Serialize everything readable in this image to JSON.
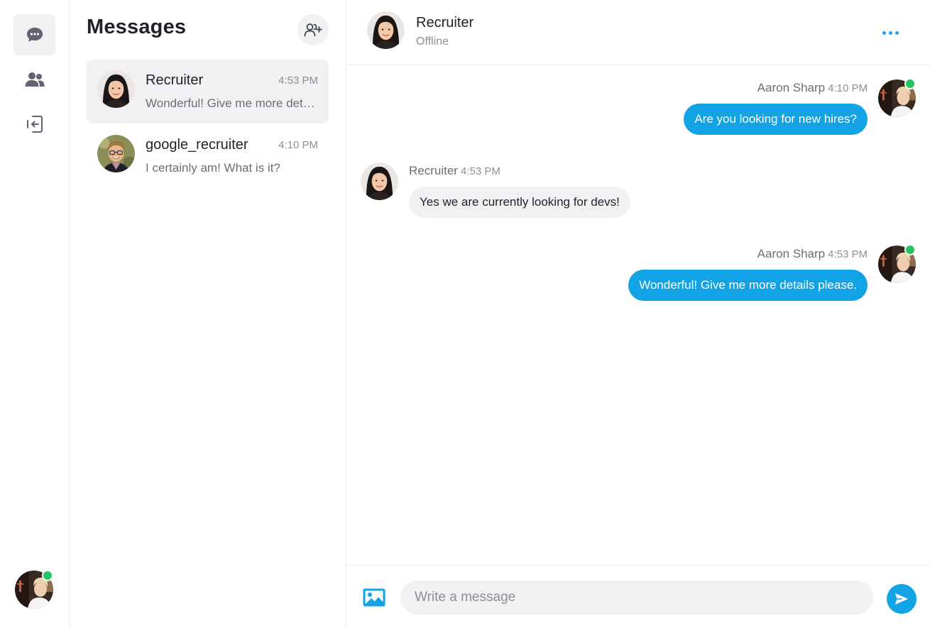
{
  "sidebar": {
    "nav": [
      {
        "name": "messages",
        "icon": "chat-bubble-icon",
        "active": true
      },
      {
        "name": "contacts",
        "icon": "users-icon",
        "active": false
      },
      {
        "name": "logout",
        "icon": "logout-icon",
        "active": false
      }
    ],
    "current_user_avatar": "avatar-aaron-sharp",
    "current_user_online": true
  },
  "conversations": {
    "title": "Messages",
    "add_icon": "add-user-icon",
    "items": [
      {
        "name": "Recruiter",
        "time": "4:53 PM",
        "preview": "Wonderful! Give me more details please.",
        "active": true
      },
      {
        "name": "google_recruiter",
        "time": "4:10 PM",
        "preview": "I certainly am! What is it?",
        "active": false
      }
    ]
  },
  "chat": {
    "header": {
      "name": "Recruiter",
      "status": "Offline",
      "more_icon": "more-horizontal-icon"
    },
    "messages": [
      {
        "sender": "Aaron Sharp",
        "time": "4:10 PM",
        "text": "Are you looking for new hires?",
        "direction": "outgoing"
      },
      {
        "sender": "Recruiter",
        "time": "4:53 PM",
        "text": "Yes we are currently looking for devs!",
        "direction": "incoming"
      },
      {
        "sender": "Aaron Sharp",
        "time": "4:53 PM",
        "text": "Wonderful! Give me more details please.",
        "direction": "outgoing"
      }
    ],
    "composer": {
      "placeholder": "Write a message",
      "value": "",
      "image_icon": "image-icon",
      "send_icon": "send-icon"
    }
  },
  "colors": {
    "accent": "#12a3e6",
    "online": "#22c55e",
    "muted_bg": "#f1f1f3",
    "text": "#1f2328",
    "muted_text": "#8d8f95"
  }
}
